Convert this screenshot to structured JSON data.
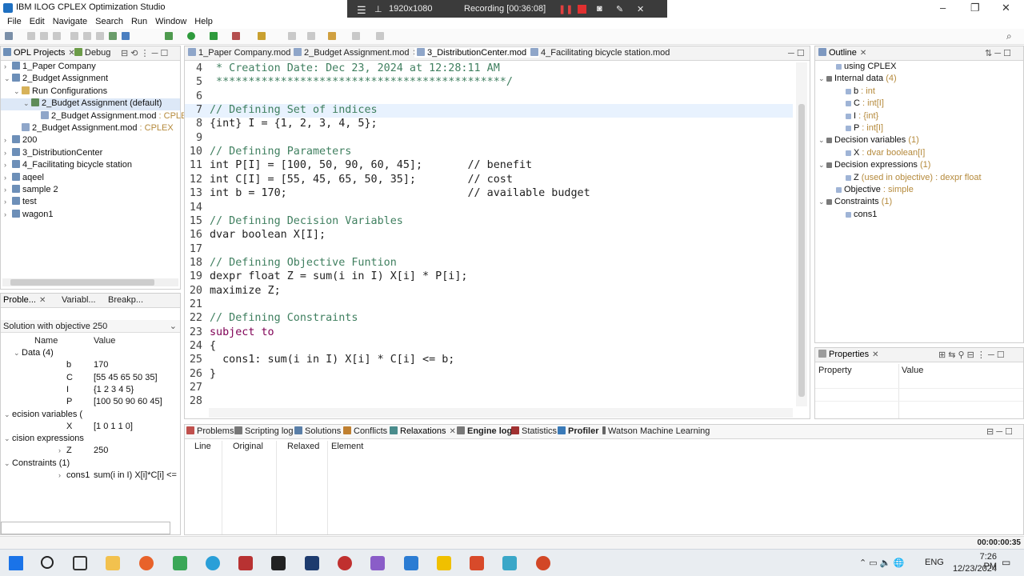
{
  "window": {
    "title": "IBM ILOG CPLEX Optimization Studio"
  },
  "recording": {
    "resolution": "1920x1080",
    "status": "Recording [00:36:08]"
  },
  "menu": [
    "File",
    "Edit",
    "Navigate",
    "Search",
    "Run",
    "Window",
    "Help"
  ],
  "projects_panel": {
    "tabs": [
      "OPL Projects",
      "Debug"
    ],
    "tree": [
      {
        "label": "1_Paper Company",
        "indent": 0,
        "icon": "proj",
        "exp": ">"
      },
      {
        "label": "2_Budget Assignment",
        "indent": 0,
        "icon": "proj",
        "exp": "v"
      },
      {
        "label": "Run Configurations",
        "indent": 1,
        "icon": "folder",
        "exp": "v"
      },
      {
        "label": "2_Budget Assignment (default)",
        "indent": 2,
        "icon": "cfg",
        "exp": "v",
        "selected": true
      },
      {
        "label": "2_Budget Assignment.mod",
        "indent": 3,
        "icon": "file",
        "exp": "",
        "suffix": " : CPLEX"
      },
      {
        "label": "2_Budget Assignment.mod",
        "indent": 1,
        "icon": "file",
        "exp": "",
        "suffix": " : CPLEX"
      },
      {
        "label": "200",
        "indent": 0,
        "icon": "proj",
        "exp": ">"
      },
      {
        "label": "3_DistributionCenter",
        "indent": 0,
        "icon": "proj",
        "exp": ">"
      },
      {
        "label": "4_Facilitating bicycle station",
        "indent": 0,
        "icon": "proj",
        "exp": ">"
      },
      {
        "label": "aqeel",
        "indent": 0,
        "icon": "proj",
        "exp": ">"
      },
      {
        "label": "sample 2",
        "indent": 0,
        "icon": "proj",
        "exp": ">"
      },
      {
        "label": "test",
        "indent": 0,
        "icon": "proj",
        "exp": ">"
      },
      {
        "label": "wagon1",
        "indent": 0,
        "icon": "proj",
        "exp": ">"
      }
    ]
  },
  "problems_panel": {
    "tabs": [
      "Proble...",
      "Variabl...",
      "Breakp..."
    ],
    "solution": "Solution with objective 250",
    "col_name": "Name",
    "col_value": "Value",
    "rows": [
      {
        "exp": "v",
        "name": "Data (4)",
        "value": "",
        "indent": 1,
        "group": true
      },
      {
        "exp": "",
        "name": "b",
        "value": "170",
        "indent": 2
      },
      {
        "exp": "",
        "name": "C",
        "value": "[55 45 65 50 35]",
        "indent": 2
      },
      {
        "exp": "",
        "name": "I",
        "value": "{1 2 3 4 5}",
        "indent": 2
      },
      {
        "exp": "",
        "name": "P",
        "value": "[100 50 90 60 45]",
        "indent": 2
      },
      {
        "exp": "v",
        "name": "ecision variables (",
        "value": "",
        "indent": 0,
        "group": true
      },
      {
        "exp": "",
        "name": "X",
        "value": "[1 0 1 1 0]",
        "indent": 2
      },
      {
        "exp": "v",
        "name": "cision expressions",
        "value": "",
        "indent": 0,
        "group": true
      },
      {
        "exp": ">",
        "name": "Z",
        "value": "250",
        "indent": 2
      },
      {
        "exp": "v",
        "name": "Constraints (1)",
        "value": "",
        "indent": 0,
        "group": true
      },
      {
        "exp": ">",
        "name": "cons1",
        "value": "sum(i in I) X[i]*C[i] <= ...",
        "indent": 1
      }
    ]
  },
  "editor": {
    "tabs": [
      "1_Paper Company.mod",
      "2_Budget Assignment.mod",
      "3_DistributionCenter.mod",
      "4_Facilitating bicycle station.mod"
    ],
    "lines": [
      {
        "n": "4",
        "t": " * Creation Date: Dec 23, 2024 at 12:28:11 AM",
        "c": "cm"
      },
      {
        "n": "5",
        "t": " *********************************************/",
        "c": "cm"
      },
      {
        "n": "6",
        "t": "",
        "c": ""
      },
      {
        "n": "7",
        "t": "// Defining Set of indices",
        "c": "cm",
        "hl": true
      },
      {
        "n": "8",
        "t": "{int} I = {1, 2, 3, 4, 5};",
        "c": ""
      },
      {
        "n": "9",
        "t": "",
        "c": ""
      },
      {
        "n": "10",
        "t": "// Defining Parameters",
        "c": "cm"
      },
      {
        "n": "11",
        "t": "int P[I] = [100, 50, 90, 60, 45];       // benefit",
        "c": ""
      },
      {
        "n": "12",
        "t": "int C[I] = [55, 45, 65, 50, 35];        // cost",
        "c": ""
      },
      {
        "n": "13",
        "t": "int b = 170;                            // available budget",
        "c": ""
      },
      {
        "n": "14",
        "t": "",
        "c": ""
      },
      {
        "n": "15",
        "t": "// Defining Decision Variables",
        "c": "cm"
      },
      {
        "n": "16",
        "t": "dvar boolean X[I];",
        "c": ""
      },
      {
        "n": "17",
        "t": "",
        "c": ""
      },
      {
        "n": "18",
        "t": "// Defining Objective Funtion",
        "c": "cm"
      },
      {
        "n": "19",
        "t": "dexpr float Z = sum(i in I) X[i] * P[i];",
        "c": ""
      },
      {
        "n": "20",
        "t": "maximize Z;",
        "c": ""
      },
      {
        "n": "21",
        "t": "",
        "c": ""
      },
      {
        "n": "22",
        "t": "// Defining Constraints",
        "c": "cm"
      },
      {
        "n": "23",
        "t": "subject to",
        "c": "kw"
      },
      {
        "n": "24",
        "t": "{",
        "c": ""
      },
      {
        "n": "25",
        "t": "  cons1: sum(i in I) X[i] * C[i] <= b;",
        "c": ""
      },
      {
        "n": "26",
        "t": "}",
        "c": ""
      },
      {
        "n": "27",
        "t": "",
        "c": ""
      },
      {
        "n": "28",
        "t": "",
        "c": ""
      }
    ]
  },
  "outline_panel": {
    "title": "Outline",
    "items": [
      {
        "exp": "",
        "label": "using CPLEX",
        "extra": "",
        "indent": 1
      },
      {
        "exp": "v",
        "label": "Internal data",
        "extra": " (4)",
        "indent": 0
      },
      {
        "exp": "",
        "label": "b",
        "extra": " : int",
        "indent": 2
      },
      {
        "exp": "",
        "label": "C",
        "extra": " : int[I]",
        "indent": 2
      },
      {
        "exp": "",
        "label": "I",
        "extra": " : {int}",
        "indent": 2
      },
      {
        "exp": "",
        "label": "P",
        "extra": " : int[I]",
        "indent": 2
      },
      {
        "exp": "v",
        "label": "Decision variables",
        "extra": " (1)",
        "indent": 0
      },
      {
        "exp": "",
        "label": "X",
        "extra": " : dvar boolean[I]",
        "indent": 2
      },
      {
        "exp": "v",
        "label": "Decision expressions",
        "extra": " (1)",
        "indent": 0
      },
      {
        "exp": "",
        "label": "Z",
        "extra": " (used in objective) : dexpr float",
        "indent": 2
      },
      {
        "exp": "",
        "label": "Objective",
        "extra": " : simple",
        "indent": 1
      },
      {
        "exp": "v",
        "label": "Constraints",
        "extra": " (1)",
        "indent": 0
      },
      {
        "exp": "",
        "label": "cons1",
        "extra": "",
        "indent": 2
      }
    ]
  },
  "properties_panel": {
    "title": "Properties",
    "col_property": "Property",
    "col_value": "Value"
  },
  "bottom_panel": {
    "tabs": [
      "Problems",
      "Scripting log",
      "Solutions",
      "Conflicts",
      "Relaxations",
      "Engine log",
      "Statistics",
      "Profiler",
      "Watson Machine Learning"
    ],
    "columns": [
      "Line",
      "Original",
      "Relaxed",
      "Element"
    ]
  },
  "status": {
    "timer": "00:00:00:35"
  },
  "clock": {
    "time": "7:26 PM",
    "date": "12/23/2024",
    "lang": "ENG"
  }
}
